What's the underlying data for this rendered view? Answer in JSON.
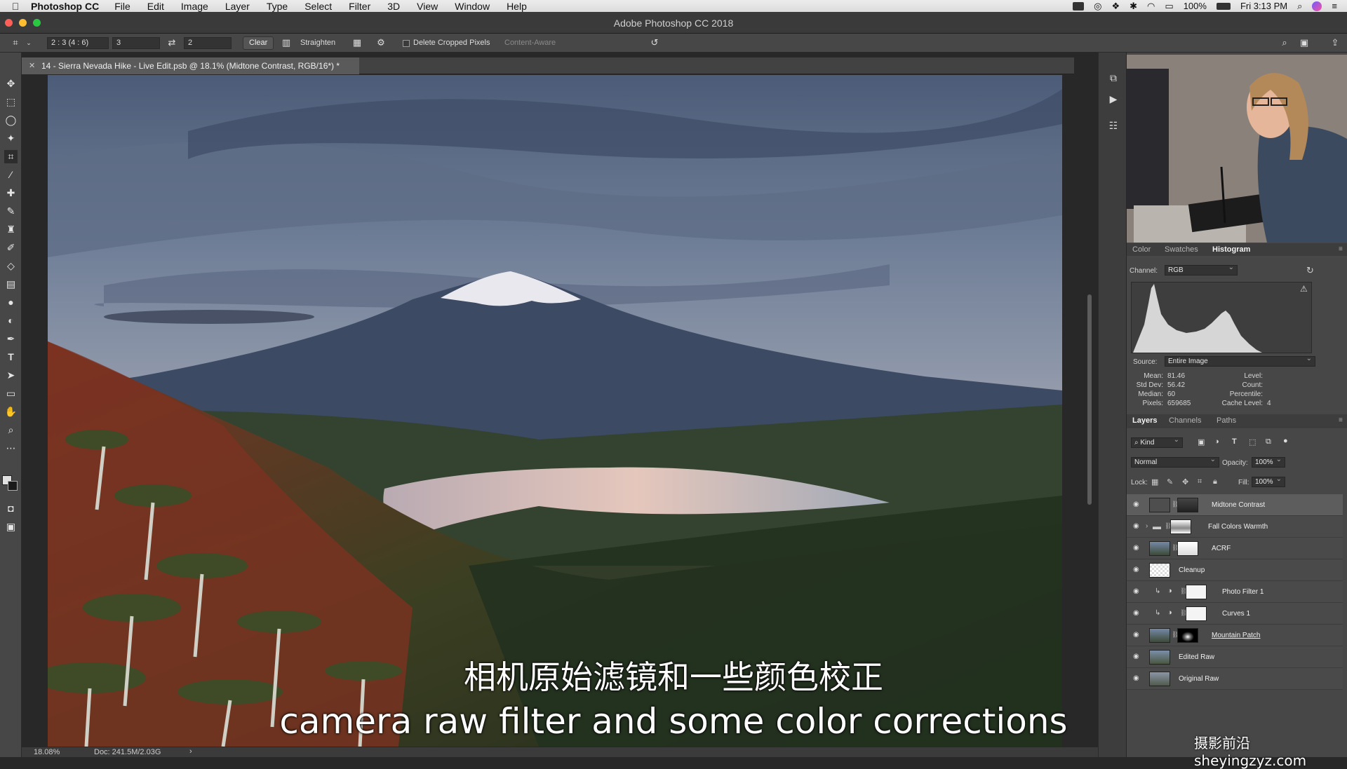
{
  "menubar": {
    "app_name": "Photoshop CC",
    "items": [
      "File",
      "Edit",
      "Image",
      "Layer",
      "Type",
      "Select",
      "Filter",
      "3D",
      "View",
      "Window",
      "Help"
    ],
    "battery": "100%",
    "clock": "Fri 3:13 PM"
  },
  "window": {
    "title": "Adobe Photoshop CC 2018"
  },
  "options": {
    "ratio_select": "2 : 3 (4 : 6)",
    "width_value": "3",
    "height_value": "2",
    "clear_label": "Clear",
    "straighten_label": "Straighten",
    "delete_cropped_label": "Delete Cropped Pixels",
    "content_aware_label": "Content-Aware"
  },
  "document": {
    "tab_title": "14 - Sierra Nevada Hike - Live Edit.psb @ 18.1% (Midtone Contrast, RGB/16*) *"
  },
  "subtitles": {
    "zh": "相机原始滤镜和一些颜色校正",
    "en": "camera raw filter and some color corrections"
  },
  "status": {
    "zoom": "18.08%",
    "doc": "Doc: 241.5M/2.03G",
    "arrow": "›"
  },
  "histogram_panel": {
    "tabs": [
      "Color",
      "Swatches",
      "Histogram"
    ],
    "active_tab": "Histogram",
    "channel_label": "Channel:",
    "channel_value": "RGB",
    "source_label": "Source:",
    "source_value": "Entire Image",
    "stats_left": [
      {
        "label": "Mean:",
        "value": "81.46"
      },
      {
        "label": "Std Dev:",
        "value": "56.42"
      },
      {
        "label": "Median:",
        "value": "60"
      },
      {
        "label": "Pixels:",
        "value": "659685"
      }
    ],
    "stats_right": [
      {
        "label": "Level:",
        "value": ""
      },
      {
        "label": "Count:",
        "value": ""
      },
      {
        "label": "Percentile:",
        "value": ""
      },
      {
        "label": "Cache Level:",
        "value": "4"
      }
    ]
  },
  "layers_panel": {
    "tabs": [
      "Layers",
      "Channels",
      "Paths"
    ],
    "active_tab": "Layers",
    "filter_label": "Kind",
    "blend_mode": "Normal",
    "opacity_label": "Opacity:",
    "opacity_value": "100%",
    "lock_label": "Lock:",
    "fill_label": "Fill:",
    "fill_value": "100%",
    "layers": [
      {
        "name": "Midtone Contrast",
        "kind": "adjustment",
        "selected": true
      },
      {
        "name": "Fall Colors Warmth",
        "kind": "group"
      },
      {
        "name": "ACRF",
        "kind": "smart"
      },
      {
        "name": "Cleanup",
        "kind": "transparent"
      },
      {
        "name": "Photo Filter 1",
        "kind": "clipped-adjustment"
      },
      {
        "name": "Curves 1",
        "kind": "clipped-adjustment"
      },
      {
        "name": "Mountain Patch",
        "kind": "masked"
      },
      {
        "name": "Edited Raw",
        "kind": "pixel"
      },
      {
        "name": "Original Raw",
        "kind": "pixel"
      }
    ]
  },
  "watermark": "摄影前沿 sheyingzyz.com",
  "colors": {
    "panel_bg": "#474747",
    "app_bg": "#282828",
    "selected_layer": "#5d5d5d"
  }
}
